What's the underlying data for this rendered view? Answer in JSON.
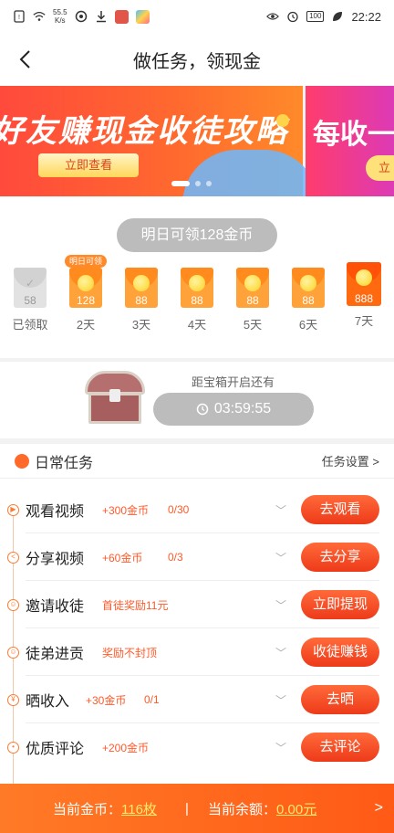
{
  "status_bar": {
    "net_speed": "55.5\nK/s",
    "battery": "100",
    "time": "22:22"
  },
  "nav": {
    "title": "做任务，领现金"
  },
  "banner": {
    "slide1_headline": "好友赚现金收徒攻略",
    "slide1_cta": "立即查看",
    "slide2_headline": "每收一",
    "slide2_cta": "立"
  },
  "checkin": {
    "tomorrow": "明日可领128金币",
    "next_tag": "明日可领",
    "days": [
      {
        "amount": "58",
        "label": "已领取",
        "claimed": true
      },
      {
        "amount": "128",
        "label": "2天"
      },
      {
        "amount": "88",
        "label": "3天"
      },
      {
        "amount": "88",
        "label": "4天"
      },
      {
        "amount": "88",
        "label": "5天"
      },
      {
        "amount": "88",
        "label": "6天"
      },
      {
        "amount": "888",
        "label": "7天"
      }
    ]
  },
  "chest": {
    "caption": "距宝箱开启还有",
    "countdown": "03:59:55"
  },
  "tasks": {
    "title": "日常任务",
    "settings": "任务设置 >",
    "items": [
      {
        "name": "观看视频",
        "reward": "+300金币",
        "progress": "0/30",
        "button": "去观看"
      },
      {
        "name": "分享视频",
        "reward": "+60金币",
        "progress": "0/3",
        "button": "去分享"
      },
      {
        "name": "邀请收徒",
        "reward": "首徒奖励11元",
        "progress": "",
        "button": "立即提现"
      },
      {
        "name": "徒弟进贡",
        "reward": "奖励不封顶",
        "progress": "",
        "button": "收徒赚钱"
      },
      {
        "name": "晒收入",
        "reward": "+30金币",
        "progress": "0/1",
        "button": "去晒"
      },
      {
        "name": "优质评论",
        "reward": "+200金币",
        "progress": "",
        "button": "去评论"
      }
    ]
  },
  "footer": {
    "coins_label": "当前金币：",
    "coins_value": "116枚",
    "separator": "|",
    "balance_label": "当前余额：",
    "balance_value": "0.00元"
  }
}
